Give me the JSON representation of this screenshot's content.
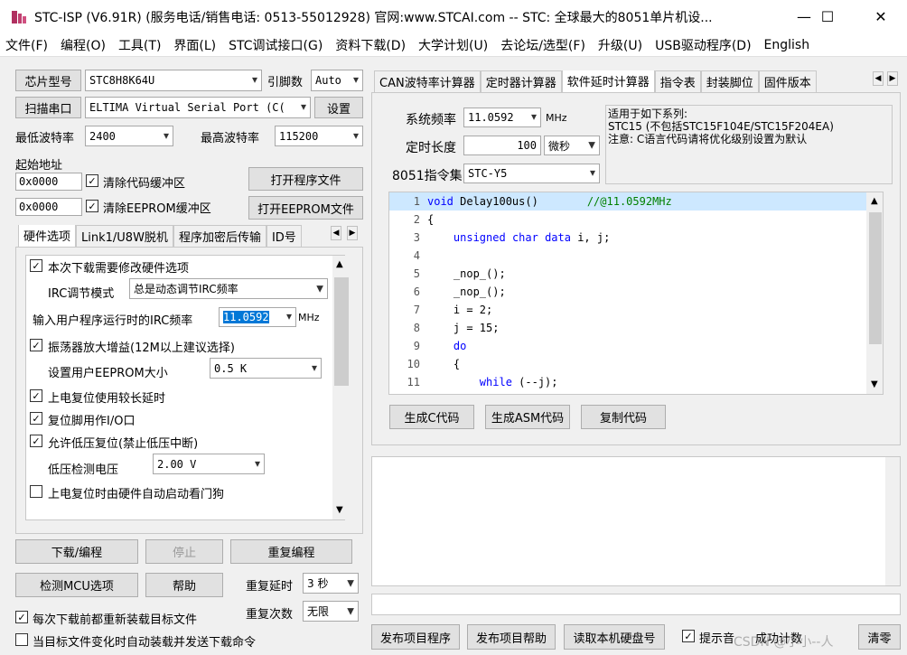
{
  "window": {
    "title": "STC-ISP (V6.91R) (服务电话/销售电话: 0513-55012928) 官网:www.STCAI.com  -- STC: 全球最大的8051单片机设...",
    "minimize": "—",
    "maximize": "☐",
    "close": "✕"
  },
  "menu": [
    "文件(F)",
    "编程(O)",
    "工具(T)",
    "界面(L)",
    "STC调试接口(G)",
    "资料下载(D)",
    "大学计划(U)",
    "去论坛/选型(F)",
    "升级(U)",
    "USB驱动程序(D)",
    "English"
  ],
  "left": {
    "chip_btn": "芯片型号",
    "chip_value": "STC8H8K64U",
    "pin_label": "引脚数",
    "pin_value": "Auto",
    "scan_btn": "扫描串口",
    "port_value": "ELTIMA Virtual Serial Port (C(",
    "settings_btn": "设置",
    "min_baud_label": "最低波特率",
    "min_baud_value": "2400",
    "max_baud_label": "最高波特率",
    "max_baud_value": "115200",
    "start_addr_label": "起始地址",
    "addr1": "0x0000",
    "clear_code_label": "清除代码缓冲区",
    "open_prog_btn": "打开程序文件",
    "addr2": "0x0000",
    "clear_eeprom_label": "清除EEPROM缓冲区",
    "open_eeprom_btn": "打开EEPROM文件",
    "tabs": [
      "硬件选项",
      "Link1/U8W脱机",
      "程序加密后传输",
      "ID号"
    ],
    "opts": {
      "modify_hw": "本次下载需要修改硬件选项",
      "irc_mode_label": "IRC调节模式",
      "irc_mode_value": "总是动态调节IRC频率",
      "irc_freq_label": "输入用户程序运行时的IRC频率",
      "irc_freq_value": "11.0592",
      "irc_unit": "MHz",
      "osc_gain": "振荡器放大增益(12M以上建议选择)",
      "eeprom_label": "设置用户EEPROM大小",
      "eeprom_value": "0.5 K",
      "long_delay": "上电复位使用较长延时",
      "reset_io": "复位脚用作I/O口",
      "low_volt_reset": "允许低压复位(禁止低压中断)",
      "low_volt_label": "低压检测电压",
      "low_volt_value": "2.00 V",
      "watchdog": "上电复位时由硬件自动启动看门狗"
    },
    "download_btn": "下载/编程",
    "stop_btn": "停止",
    "reprogram_btn": "重复编程",
    "detect_btn": "检测MCU选项",
    "help_btn": "帮助",
    "repeat_delay_label": "重复延时",
    "repeat_delay_value": "3 秒",
    "repeat_count_label": "重复次数",
    "repeat_count_value": "无限",
    "reload_each": "每次下载前都重新装载目标文件",
    "auto_reload": "当目标文件变化时自动装载并发送下载命令"
  },
  "right": {
    "tabs": [
      "CAN波特率计算器",
      "定时器计算器",
      "软件延时计算器",
      "指令表",
      "封装脚位",
      "固件版本"
    ],
    "sys_freq_label": "系统频率",
    "sys_freq_value": "11.0592",
    "sys_freq_unit": "MHz",
    "delay_len_label": "定时长度",
    "delay_len_value": "100",
    "delay_unit": "微秒",
    "instr_set_label": "8051指令集",
    "instr_set_value": "STC-Y5",
    "info_text": "适用于如下系列:\nSTC15 (不包括STC15F104E/STC15F204EA)\n注意: C语言代码请将优化级别设置为默认",
    "code_lines": [
      {
        "n": "1",
        "t": "void Delay100us()",
        "c": "//@11.0592MHz"
      },
      {
        "n": "2",
        "t": "{",
        "c": ""
      },
      {
        "n": "3",
        "t": "    unsigned char data i, j;",
        "c": ""
      },
      {
        "n": "4",
        "t": "",
        "c": ""
      },
      {
        "n": "5",
        "t": "    _nop_();",
        "c": ""
      },
      {
        "n": "6",
        "t": "    _nop_();",
        "c": ""
      },
      {
        "n": "7",
        "t": "    i = 2;",
        "c": ""
      },
      {
        "n": "8",
        "t": "    j = 15;",
        "c": ""
      },
      {
        "n": "9",
        "t": "    do",
        "c": ""
      },
      {
        "n": "10",
        "t": "    {",
        "c": ""
      },
      {
        "n": "11",
        "t": "        while (--j);",
        "c": ""
      }
    ],
    "gen_c_btn": "生成C代码",
    "gen_asm_btn": "生成ASM代码",
    "copy_btn": "复制代码",
    "publish_prog_btn": "发布项目程序",
    "publish_help_btn": "发布项目帮助",
    "read_disk_btn": "读取本机硬盘号",
    "prompt_label": "提示音",
    "success_label": "成功计数",
    "clear_btn": "清零",
    "watermark": "CSDN @小小--人"
  }
}
